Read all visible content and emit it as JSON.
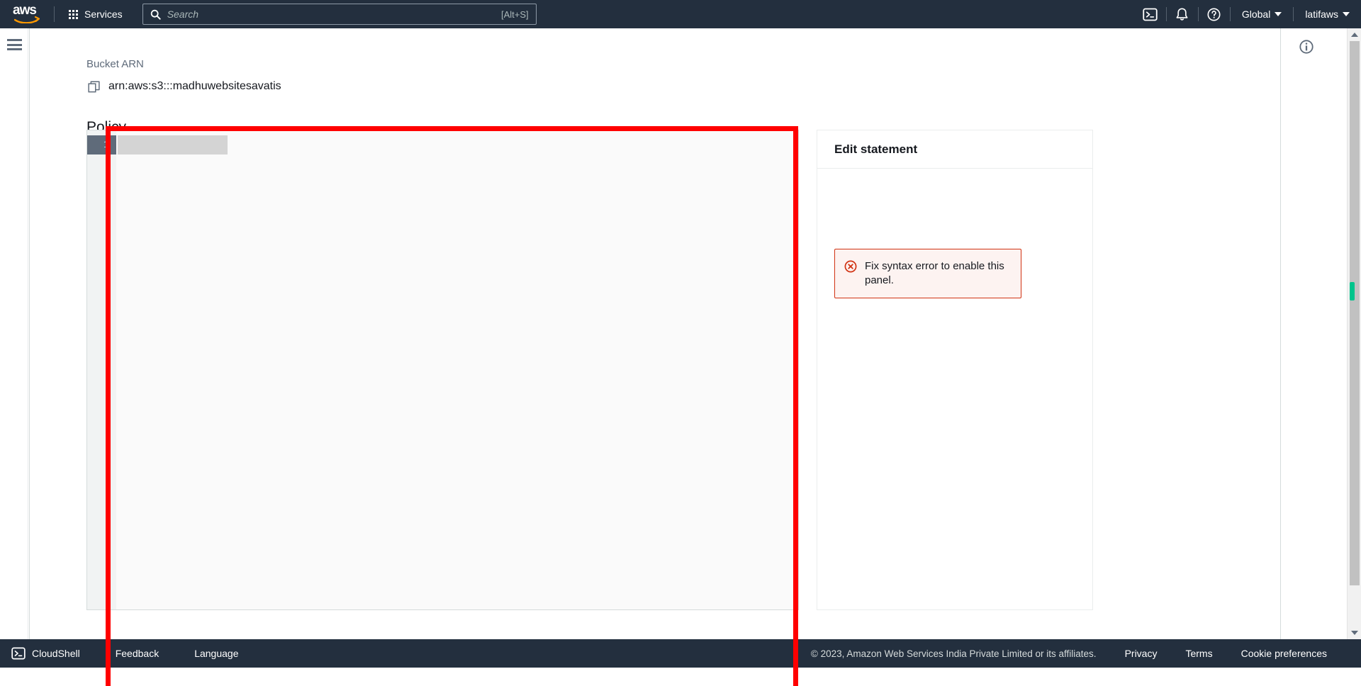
{
  "topnav": {
    "logo_text": "aws",
    "logo_name": "aws-logo",
    "services_label": "Services",
    "search": {
      "placeholder": "Search",
      "value": "",
      "shortcut": "[Alt+S]",
      "icon": "search-icon"
    },
    "cloudshell_icon": "cloudshell-terminal-icon",
    "notifications_icon": "bell-icon",
    "help_icon": "question-circle-icon",
    "region_label": "Global",
    "account_label": "latifaws"
  },
  "sidebar": {
    "toggle_icon": "hamburger-menu-icon"
  },
  "main": {
    "bucket_arn_label": "Bucket ARN",
    "bucket_arn_value": "arn:aws:s3:::madhuwebsitesavatis",
    "copy_icon": "copy-icon",
    "policy_heading": "Policy",
    "editor": {
      "line_number": "1",
      "line_content": "",
      "selection_present": true
    }
  },
  "statement_panel": {
    "title": "Edit statement",
    "alert": {
      "icon": "error-circle-x-icon",
      "message": "Fix syntax error to enable this panel."
    }
  },
  "info_rail": {
    "info_icon": "info-circle-icon"
  },
  "scrollbar": {
    "up_icon": "scroll-up-arrow-icon",
    "down_icon": "scroll-down-arrow-icon",
    "marker_color": "#00c48c"
  },
  "footer": {
    "cloudshell_label": "CloudShell",
    "cloudshell_icon": "cloudshell-terminal-icon",
    "feedback_label": "Feedback",
    "language_label": "Language",
    "copyright": "© 2023, Amazon Web Services India Private Limited or its affiliates.",
    "privacy_label": "Privacy",
    "terms_label": "Terms",
    "cookie_label": "Cookie preferences"
  },
  "annotation": {
    "color": "#ff0000"
  },
  "colors": {
    "nav_bg": "#232f3e",
    "accent_link": "#ffffff",
    "error": "#d13212",
    "gutter": "#5f6b7a"
  }
}
